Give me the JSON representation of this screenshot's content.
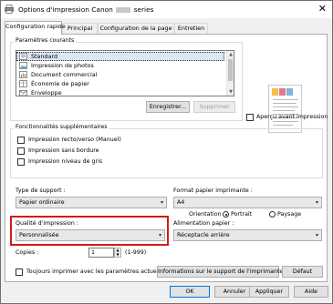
{
  "window": {
    "title_prefix": "Options d'impression Canon",
    "title_suffix": "series",
    "close_glyph": "✕"
  },
  "tabs": [
    {
      "label": "Configuration rapide",
      "active": true
    },
    {
      "label": "Principal",
      "active": false
    },
    {
      "label": "Configuration de la page",
      "active": false
    },
    {
      "label": "Entretien",
      "active": false
    }
  ],
  "settings": {
    "group_label": "Paramètres courants",
    "items": [
      {
        "label": "Standard",
        "icon": "standard-icon",
        "selected": true
      },
      {
        "label": "Impression de photos",
        "icon": "photo-icon",
        "selected": false
      },
      {
        "label": "Document commercial",
        "icon": "business-document-icon",
        "selected": false
      },
      {
        "label": "Économie de papier",
        "icon": "paper-saving-icon",
        "selected": false
      },
      {
        "label": "Enveloppe",
        "icon": "envelope-icon",
        "selected": false
      }
    ],
    "save_button": "Enregistrer...",
    "delete_button": "Supprimer",
    "preview_checkbox": "Aperçu avant impression"
  },
  "features": {
    "group_label": "Fonctionnalités supplémentaires",
    "options": [
      {
        "label": "Impression recto/verso (Manuel)",
        "checked": false
      },
      {
        "label": "Impression sans bordure",
        "checked": false
      },
      {
        "label": "Impression niveau de gris",
        "checked": false
      }
    ]
  },
  "media_type": {
    "label": "Type de support :",
    "value": "Papier ordinaire"
  },
  "paper_size": {
    "label": "Format papier imprimante :",
    "value": "A4"
  },
  "orientation": {
    "label": "Orientation :",
    "portrait": "Portrait",
    "landscape": "Paysage",
    "selected": "Portrait"
  },
  "quality": {
    "label": "Qualité d'impression :",
    "value": "Personnalisée"
  },
  "paper_source": {
    "label": "Alimentation papier :",
    "value": "Réceptacle arrière"
  },
  "copies": {
    "label": "Copies :",
    "value": "1",
    "range": "(1-999)"
  },
  "always_print": {
    "label": "Toujours imprimer avec les paramètres actuels",
    "checked": false
  },
  "media_info_button": "Informations sur le support de l'imprimante...",
  "default_button": "Défaut",
  "footer": {
    "ok": "OK",
    "cancel": "Annuler",
    "apply": "Appliquer",
    "help": "Aide"
  },
  "colors": {
    "highlight": "#d11a1a",
    "selection": "#dbe6f7",
    "default_border": "#0078d7"
  }
}
